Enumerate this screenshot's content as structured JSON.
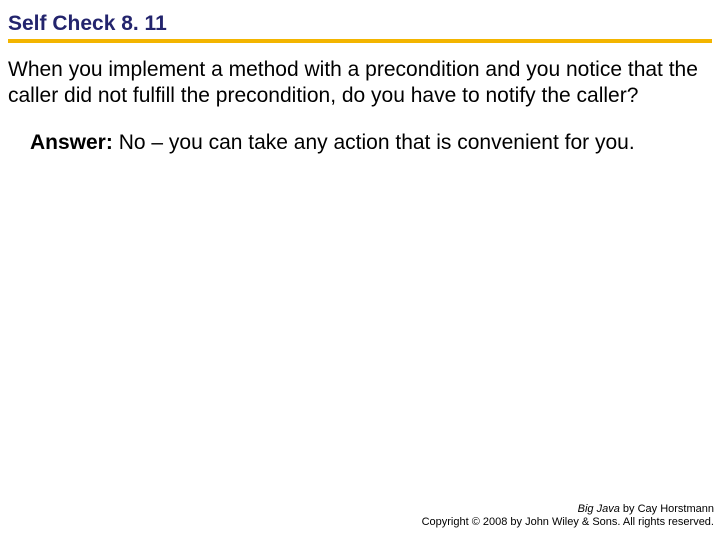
{
  "title": "Self Check 8. 11",
  "question": "When you implement a method with a precondition and you notice that the caller did not fulfill the precondition, do you have to notify the caller?",
  "answer_label": "Answer:",
  "answer_text": " No – you can take any action that is convenient for you.",
  "footer": {
    "book_title": "Big Java",
    "byline": " by Cay Horstmann",
    "copyright": "Copyright © 2008 by John Wiley & Sons. All rights reserved."
  }
}
